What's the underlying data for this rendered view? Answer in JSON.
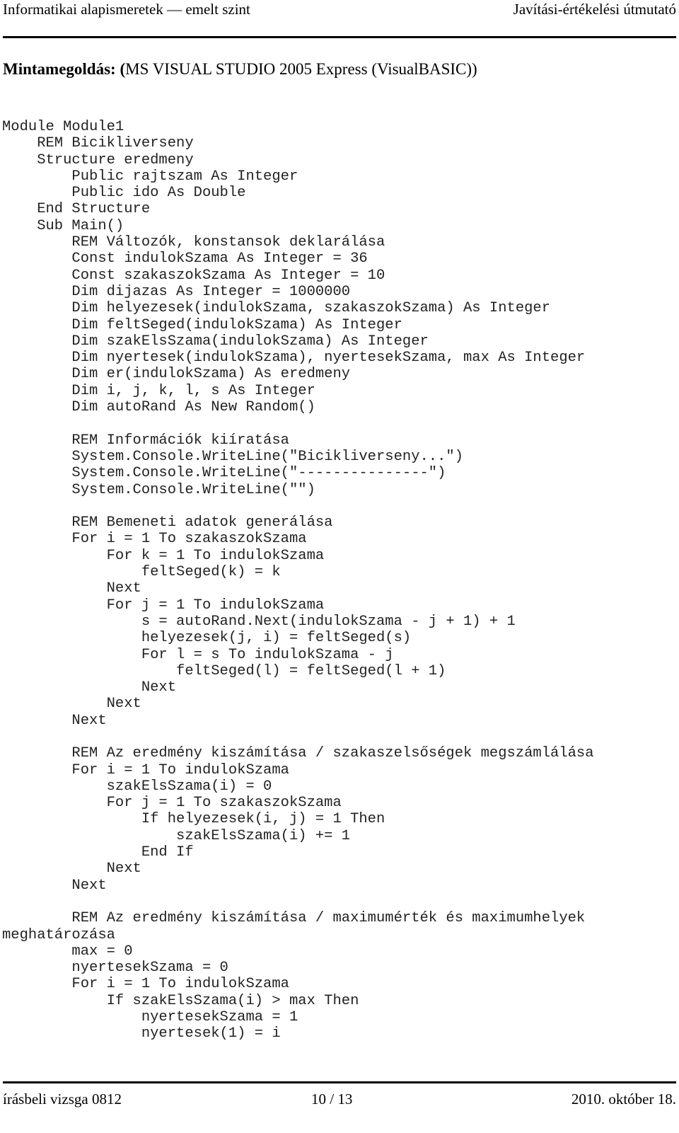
{
  "header": {
    "left": "Informatikai alapismeretek — emelt szint",
    "right": "Javítási-értékelési útmutató"
  },
  "title": {
    "bold": "Mintamegoldás: (",
    "normal": "MS VISUAL STUDIO 2005 Express (VisualBASIC))"
  },
  "code_lines": [
    "Module Module1",
    "    REM Bicikliverseny",
    "    Structure eredmeny",
    "        Public rajtszam As Integer",
    "        Public ido As Double",
    "    End Structure",
    "    Sub Main()",
    "        REM Változók, konstansok deklarálása",
    "        Const indulokSzama As Integer = 36",
    "        Const szakaszokSzama As Integer = 10",
    "        Dim dijazas As Integer = 1000000",
    "        Dim helyezesek(indulokSzama, szakaszokSzama) As Integer",
    "        Dim feltSeged(indulokSzama) As Integer",
    "        Dim szakElsSzama(indulokSzama) As Integer",
    "        Dim nyertesek(indulokSzama), nyertesekSzama, max As Integer",
    "        Dim er(indulokSzama) As eredmeny",
    "        Dim i, j, k, l, s As Integer",
    "        Dim autoRand As New Random()",
    "",
    "        REM Információk kiíratása",
    "        System.Console.WriteLine(\"Bicikliverseny...\")",
    "        System.Console.WriteLine(\"---------------\")",
    "        System.Console.WriteLine(\"\")",
    "",
    "        REM Bemeneti adatok generálása",
    "        For i = 1 To szakaszokSzama",
    "            For k = 1 To indulokSzama",
    "                feltSeged(k) = k",
    "            Next",
    "            For j = 1 To indulokSzama",
    "                s = autoRand.Next(indulokSzama - j + 1) + 1",
    "                helyezesek(j, i) = feltSeged(s)",
    "                For l = s To indulokSzama - j",
    "                    feltSeged(l) = feltSeged(l + 1)",
    "                Next",
    "            Next",
    "        Next",
    "",
    "        REM Az eredmény kiszámítása / szakaszelsőségek megszámlálása",
    "        For i = 1 To indulokSzama",
    "            szakElsSzama(i) = 0",
    "            For j = 1 To szakaszokSzama",
    "                If helyezesek(i, j) = 1 Then",
    "                    szakElsSzama(i) += 1",
    "                End If",
    "            Next",
    "        Next",
    "",
    "        REM Az eredmény kiszámítása / maximumérték és maximumhelyek",
    "meghatározása",
    "        max = 0",
    "        nyertesekSzama = 0",
    "        For i = 1 To indulokSzama",
    "            If szakElsSzama(i) > max Then",
    "                nyertesekSzama = 1",
    "                nyertesek(1) = i"
  ],
  "footer": {
    "left": "írásbeli vizsga 0812",
    "center": "10 / 13",
    "right": "2010. október 18."
  }
}
